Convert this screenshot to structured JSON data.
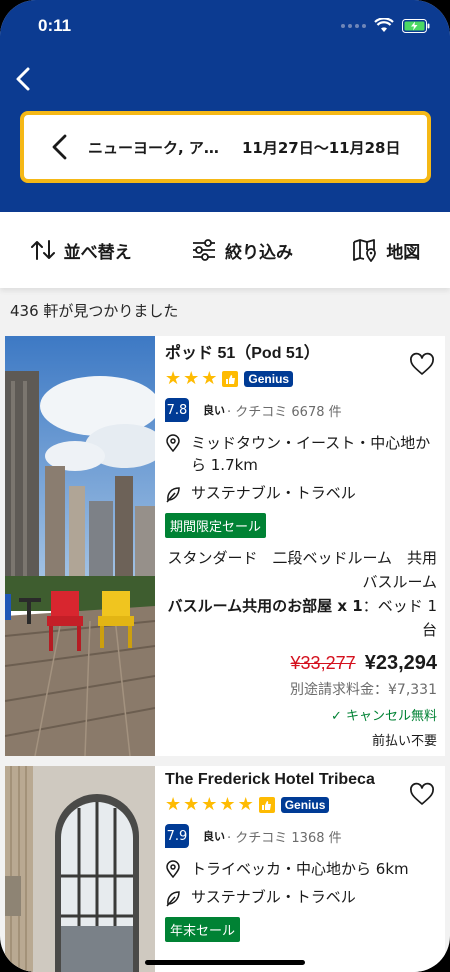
{
  "status_bar": {
    "time": "0:11"
  },
  "search": {
    "place": "ニューヨーク, ア…",
    "dates": "11月27日〜11月28日"
  },
  "toolbar": {
    "sort": "並べ替え",
    "filter": "絞り込み",
    "map": "地図"
  },
  "results_count": "436 軒が見つかりました",
  "colors": {
    "header": "#0c3b91",
    "accent": "#f5b816",
    "genius": "#003b95",
    "sale": "#008234",
    "strike": "#d4111e"
  },
  "hotels": [
    {
      "name": "ポッド 51（Pod 51）",
      "stars": 3,
      "genius": "Genius",
      "score": "7.8",
      "review_word": "良い",
      "review_count": "· クチコミ 6678 件",
      "location": "ミッドタウン・イースト・中心地から 1.7km",
      "sustainable": "サステナブル・トラベル",
      "sale_badge": "期間限定セール",
      "room_type": "スタンダード　二段ベッドルーム　共用バスルーム",
      "room_bold": "バスルーム共用のお部屋 x 1",
      "room_rest": "：ベッド 1 台",
      "old_price": "¥33,277",
      "new_price": "¥23,294",
      "extra_fee": "別途請求料金：¥7,331",
      "cancel": "✓ キャンセル無料",
      "prepay": "前払い不要"
    },
    {
      "name": "The Frederick Hotel Tribeca",
      "stars": 5,
      "genius": "Genius",
      "score": "7.9",
      "review_word": "良い",
      "review_count": "· クチコミ 1368 件",
      "location": "トライベッカ・中心地から 6km",
      "sustainable": "サステナブル・トラベル",
      "sale_badge": "年末セール"
    }
  ]
}
